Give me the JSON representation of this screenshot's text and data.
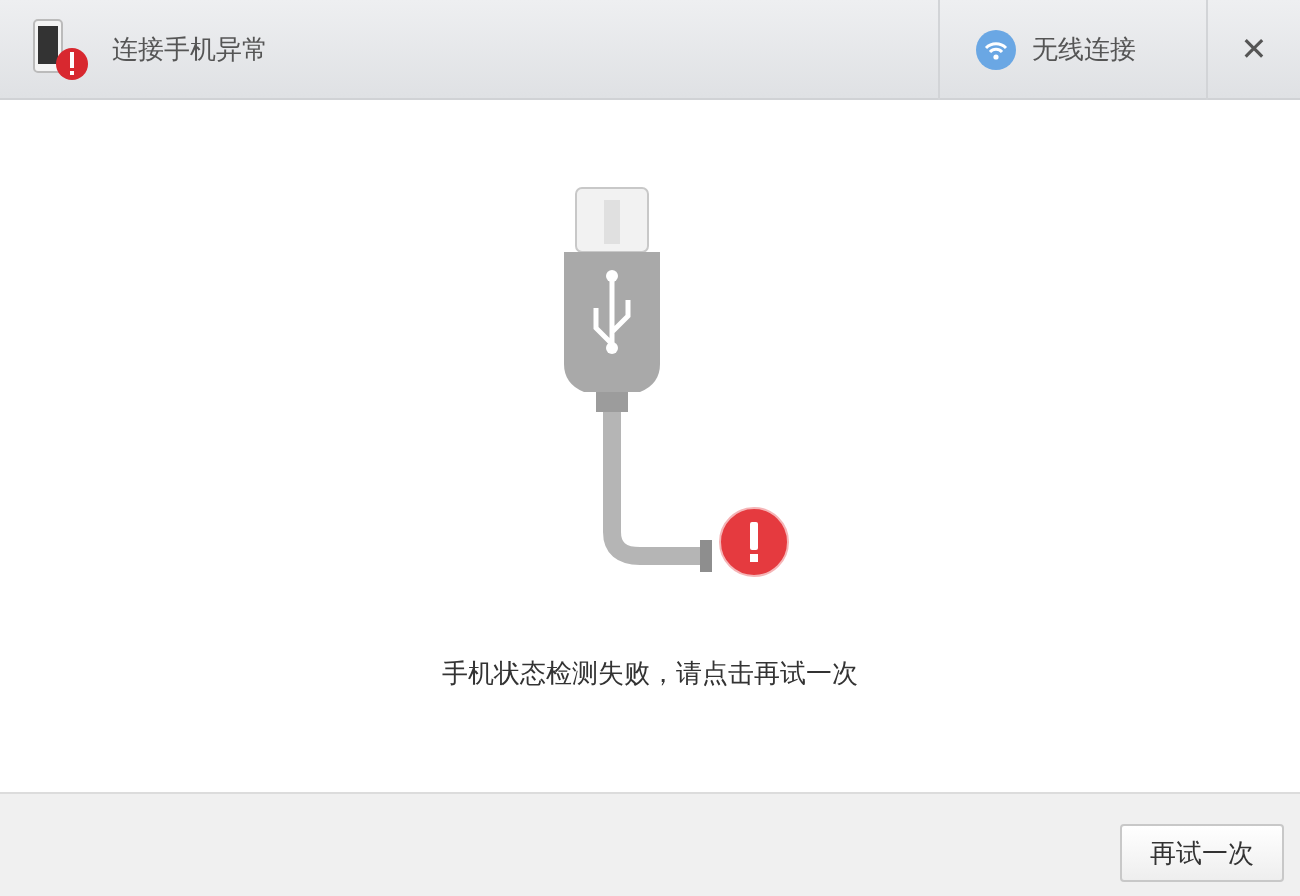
{
  "window": {
    "title": "连接手机异常"
  },
  "wireless_button": {
    "label": "无线连接"
  },
  "close_button": {
    "label": "✕"
  },
  "message": "手机状态检测失败，请点击再试一次",
  "buttons": [
    "再试一次"
  ]
}
